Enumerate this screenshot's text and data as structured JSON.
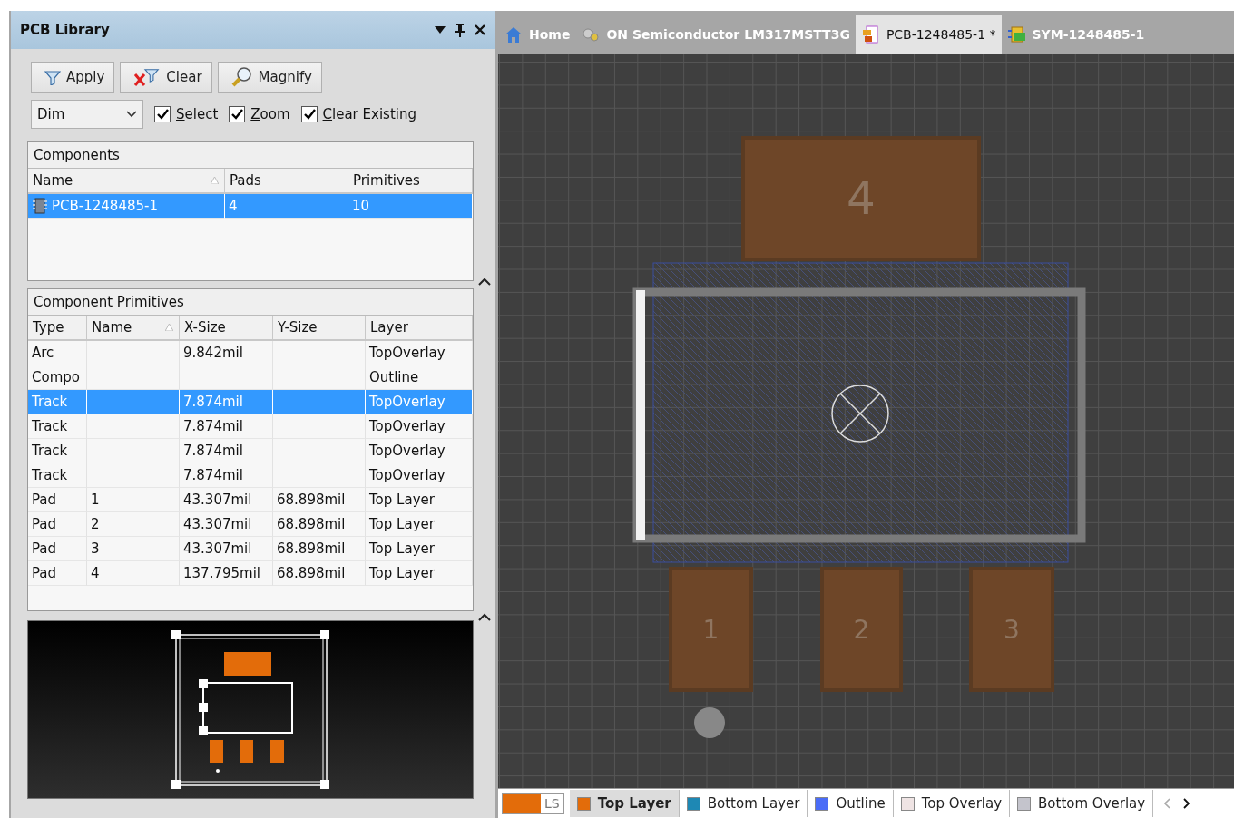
{
  "panel": {
    "title": "PCB Library",
    "buttons": [
      {
        "label": "Apply",
        "kind": "apply"
      },
      {
        "label": "Clear",
        "kind": "clear"
      },
      {
        "label": "Magnify",
        "kind": "magnify"
      }
    ],
    "mask_mode": {
      "value": "Dim"
    },
    "options": [
      {
        "label": "Select",
        "checked": true
      },
      {
        "label": "Zoom",
        "checked": true
      },
      {
        "label": "Clear Existing",
        "checked": true
      }
    ],
    "components": {
      "title": "Components",
      "columns": [
        {
          "label": "Name",
          "sorted": true
        },
        {
          "label": "Pads",
          "sorted": false
        },
        {
          "label": "Primitives",
          "sorted": false
        }
      ],
      "rows": [
        {
          "name": "PCB-1248485-1",
          "pads": "4",
          "primitives": "10",
          "selected": true
        }
      ]
    },
    "primitives": {
      "title": "Component Primitives",
      "columns": [
        {
          "label": "Type",
          "sorted": false
        },
        {
          "label": "Name",
          "sorted": true
        },
        {
          "label": "X-Size",
          "sorted": false
        },
        {
          "label": "Y-Size",
          "sorted": false
        },
        {
          "label": "Layer",
          "sorted": false
        }
      ],
      "rows": [
        {
          "type": "Arc",
          "x_size": "9.842mil",
          "layer": "TopOverlay",
          "selected": false
        },
        {
          "type": "Compo",
          "layer": "Outline",
          "selected": false
        },
        {
          "type": "Track",
          "x_size": "7.874mil",
          "layer": "TopOverlay",
          "selected": true
        },
        {
          "type": "Track",
          "x_size": "7.874mil",
          "layer": "TopOverlay",
          "selected": false
        },
        {
          "type": "Track",
          "x_size": "7.874mil",
          "layer": "TopOverlay",
          "selected": false
        },
        {
          "type": "Track",
          "x_size": "7.874mil",
          "layer": "TopOverlay",
          "selected": false
        },
        {
          "type": "Pad",
          "name": "1",
          "x_size": "43.307mil",
          "y_size": "68.898mil",
          "layer": "Top Layer",
          "selected": false
        },
        {
          "type": "Pad",
          "name": "2",
          "x_size": "43.307mil",
          "y_size": "68.898mil",
          "layer": "Top Layer",
          "selected": false
        },
        {
          "type": "Pad",
          "name": "3",
          "x_size": "43.307mil",
          "y_size": "68.898mil",
          "layer": "Top Layer",
          "selected": false
        },
        {
          "type": "Pad",
          "name": "4",
          "x_size": "137.795mil",
          "y_size": "68.898mil",
          "layer": "Top Layer",
          "selected": false
        }
      ]
    }
  },
  "tabs": [
    {
      "label": "Home",
      "kind": "home",
      "selected": false
    },
    {
      "label": "ON Semiconductor LM317MSTT3G",
      "kind": "part",
      "selected": false
    },
    {
      "label": "PCB-1248485-1 *",
      "kind": "pcb",
      "selected": true
    },
    {
      "label": "SYM-1248485-1",
      "kind": "sym",
      "selected": false
    }
  ],
  "canvas": {
    "pads": [
      {
        "label": "4"
      },
      {
        "label": "1"
      },
      {
        "label": "2"
      },
      {
        "label": "3"
      }
    ]
  },
  "layer_set": {
    "label": "LS",
    "color": "#e36c0a"
  },
  "layer_tabs": [
    {
      "label": "Top Layer",
      "color": "#e36c0a",
      "selected": true
    },
    {
      "label": "Bottom Layer",
      "color": "#1e88b4",
      "selected": false
    },
    {
      "label": "Outline",
      "color": "#4a6cf7",
      "selected": false
    },
    {
      "label": "Top Overlay",
      "color": "#efe4e4",
      "selected": false
    },
    {
      "label": "Bottom Overlay",
      "color": "#c4c4cc",
      "selected": false
    }
  ]
}
